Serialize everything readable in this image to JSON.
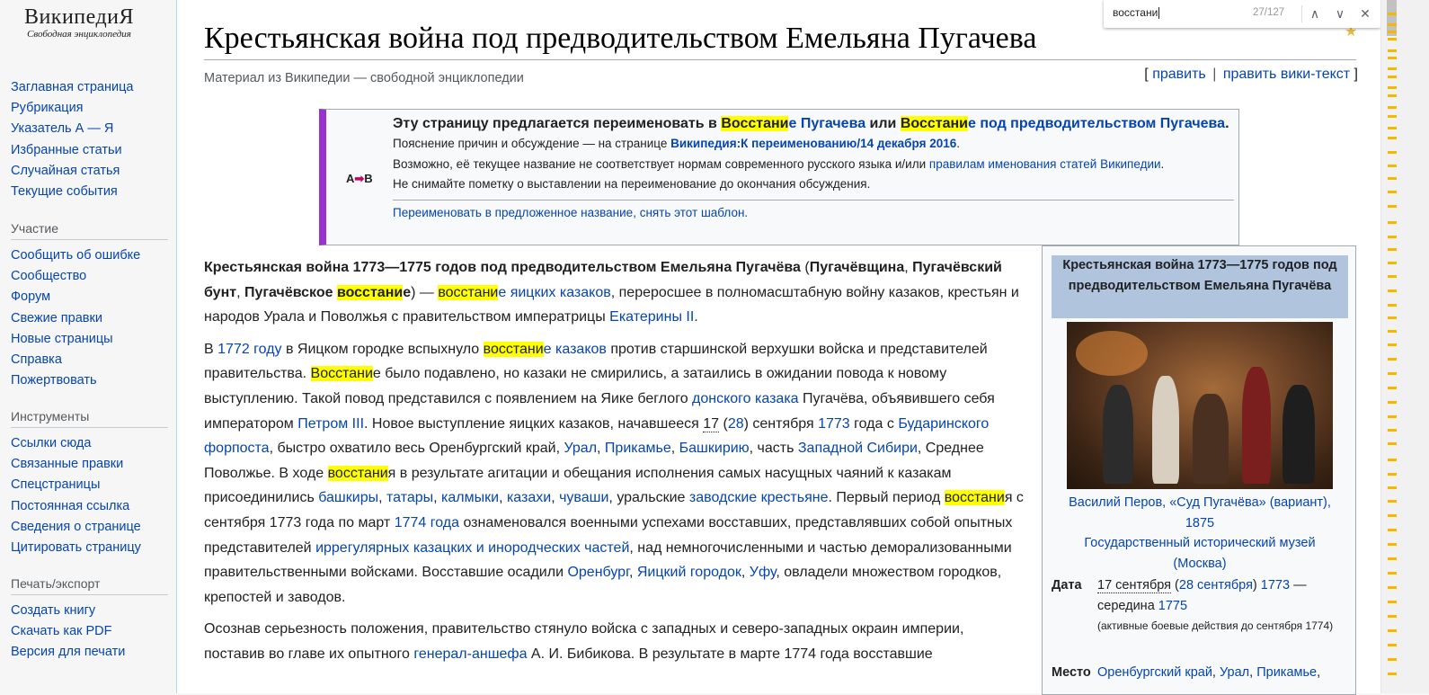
{
  "logo": {
    "word": "ВикипедиЯ",
    "tagline": "Свободная энциклопедия"
  },
  "sidebar": {
    "nav": [
      "Заглавная страница",
      "Рубрикация",
      "Указатель А — Я",
      "Избранные статьи",
      "Случайная статья",
      "Текущие события"
    ],
    "participation": {
      "heading": "Участие",
      "items": [
        "Сообщить об ошибке",
        "Сообщество",
        "Форум",
        "Свежие правки",
        "Новые страницы",
        "Справка",
        "Пожертвовать"
      ]
    },
    "tools": {
      "heading": "Инструменты",
      "items": [
        "Ссылки сюда",
        "Связанные правки",
        "Спецстраницы",
        "Постоянная ссылка",
        "Сведения о странице",
        "Цитировать страницу"
      ]
    },
    "print": {
      "heading": "Печать/экспорт",
      "items": [
        "Создать книгу",
        "Скачать как PDF",
        "Версия для печати"
      ]
    }
  },
  "page": {
    "title": "Крестьянская война под предводительством Емельяна Пугачева",
    "tagline": "Материал из Википедии — свободной энциклопедии",
    "edit": {
      "open": "[",
      "edit": "править",
      "sep": "|",
      "edit_source": "править вики-текст",
      "close": "]"
    }
  },
  "notice": {
    "icon_a": "A",
    "icon_arrow": "➡",
    "icon_b": "B",
    "head": {
      "t1": "Эту страницу предлагается переименовать в ",
      "h1": "Восстани",
      "l1": "е Пугачева",
      "t2": " или ",
      "h2": "Восстани",
      "l2": "е под предводительством Пугачева",
      "t3": "."
    },
    "line1": {
      "text": "Пояснение причин и обсуждение — на странице ",
      "link": "Википедия:К переименованию/14 декабря 2016",
      "end": "."
    },
    "line2": {
      "text": "Возможно, её текущее название не соответствует нормам современного русского языка и/или ",
      "link": "правилам именования статей Википедии",
      "end": "."
    },
    "line3": "Не снимайте пометку о выставлении на переименование до окончания обсуждения.",
    "actions": {
      "rename": "Переименовать в предложенное название",
      "sep": ", ",
      "remove": "снять этот шаблон",
      "end": "."
    }
  },
  "body": {
    "p1": {
      "b1": "Крестьянская война 1773—1775 годов под предводительством Емельяна Пугачёва",
      "t1": " (",
      "b2": "Пугачёвщина",
      "t2": ", ",
      "b3": "Пугачёвский бунт",
      "t3": ", ",
      "b4": "Пугачёвское ",
      "bh": "восстани",
      "b5": "е",
      "t4": ") — ",
      "h2": "восстани",
      "l1": "е яицких казаков",
      "t5": ", переросшее в полномасштабную войну казаков, крестьян и народов Урала и Поволжья с правительством императрицы ",
      "l2": "Екатерины II",
      "t6": "."
    },
    "p2": {
      "t1": "В ",
      "l1": "1772 году",
      "t2": " в Яицком городке вспыхнуло ",
      "h1": "восстани",
      "l2": "е казаков",
      "t3": " против старшинской верхушки войска и представителей правительства. ",
      "h2": "Восстани",
      "t4": "е было подавлено, но казаки не смирились, а затаились в ожидании повода к новому выступлению. Такой повод представился с появлением на Яике беглого ",
      "l3": "донского казака",
      "t5": " Пугачёва, объявившего себя императором ",
      "l4": "Петром III",
      "t6": ". Новое выступление яицких казаков, начавшееся ",
      "d1": "17",
      "t7": " (",
      "l5": "28",
      "t8": ") сентября ",
      "l6": "1773",
      "t9": " года с ",
      "l7": "Бударинского форпоста",
      "t10": ", быстро охватило весь Оренбургский край, ",
      "l8": "Урал",
      "t11": ", ",
      "l9": "Прикамье",
      "t12": ", ",
      "l10": "Башкирию",
      "t13": ", часть ",
      "l11": "Западной Сибири",
      "t14": ", Среднее Поволжье. В ходе ",
      "h3": "восстани",
      "t15": "я в результате агитации и обещания исполнения самых насущных чаяний к казакам присоединились ",
      "l12": "башкиры",
      "t16": ", ",
      "l13": "татары",
      "t17": ", ",
      "l14": "калмыки",
      "t18": ", ",
      "l15": "казахи",
      "t19": ", ",
      "l16": "чуваши",
      "t20": ", уральские ",
      "l17": "заводские крестьяне",
      "t21": ". Первый период ",
      "h4": "восстани",
      "t22": "я с сентября 1773 года по март ",
      "l18": "1774 года",
      "t23": " ознаменовался военными успехами восставших, представлявших собой опытных представителей ",
      "l19": "иррегулярных казацких и инородческих частей",
      "t24": ", над немногочисленными и частью деморализованными правительственными войсками. Восставшие осадили ",
      "l20": "Оренбург",
      "t25": ", ",
      "l21": "Яицкий городок",
      "t26": ", ",
      "l22": "Уфу",
      "t27": ", овладели множеством городков, крепостей и заводов."
    },
    "p3": {
      "t1": "Осознав серьезность положения, правительство стянуло войска с западных и северо-западных окраин империи, поставив во главе их опытного ",
      "l1": "генерал-аншефа",
      "t2": " А. И. Бибикова. В результате в марте 1774 года восставшие"
    }
  },
  "infobox": {
    "title": "Крестьянская война 1773—1775 годов под предводительством Емельяна Пугачёва",
    "caption": {
      "author": "Василий Перов",
      "t1": ", ",
      "work": "«Суд Пугачёва» (вариант)",
      "t2": ", ",
      "year": "1875",
      "museum": "Государственный исторический музей",
      "city_open": "(",
      "city": "Москва",
      "city_close": ")"
    },
    "date": {
      "label": "Дата",
      "d1": "17 сентября",
      "t1": " (",
      "d2": "28 сентября",
      "t2": ") ",
      "y1": "1773",
      "t3": " — середина ",
      "y2": "1775",
      "note": "(активные боевые действия до сентября 1774)"
    },
    "place": {
      "label": "Место",
      "l1": "Оренбургский край",
      "t1": ", ",
      "l2": "Урал",
      "t2": ", ",
      "l3": "Прикамье",
      "t3": ","
    }
  },
  "findbar": {
    "query": "восстани",
    "count": "27/127",
    "up": "∧",
    "down": "∨",
    "close": "✕"
  },
  "colors": {
    "link": "#0645ad",
    "highlight": "#ffff00",
    "notice_border": "#9932cc",
    "infobox_title": "#b0c4de"
  }
}
